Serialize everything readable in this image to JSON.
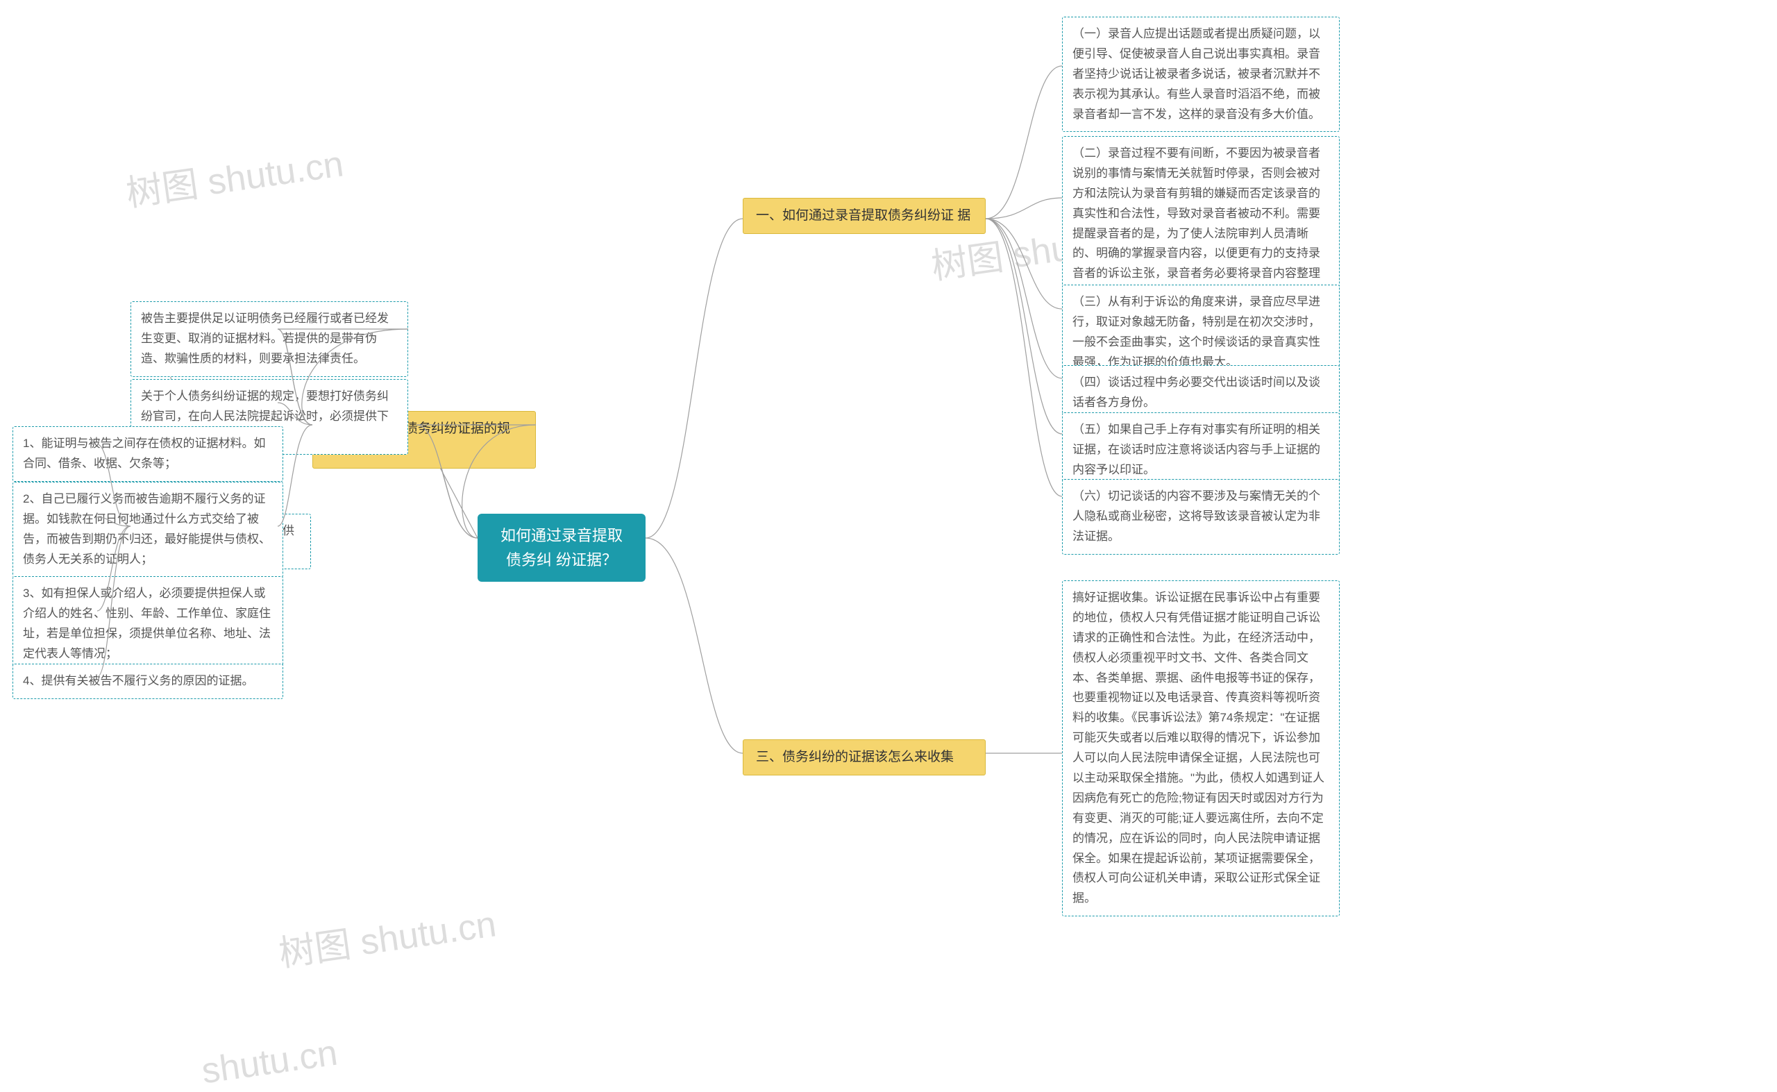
{
  "center": {
    "title": "如何通过录音提取债务纠\n纷证据？"
  },
  "branch1": {
    "title": "一、如何通过录音提取债务纠纷证\n据",
    "leaves": [
      "（一）录音人应提出话题或者提出质疑问题，以便引导、促使被录音人自己说出事实真相。录音者坚持少说话让被录者多说话，被录者沉默并不表示视为其承认。有些人录音时滔滔不绝，而被录音者却一言不发，这样的录音没有多大价值。",
      "（二）录音过程不要有间断，不要因为被录音者说别的事情与案情无关就暂时停录，否则会被对方和法院认为录音有剪辑的嫌疑而否定该录音的真实性和合法性，导致对录音者被动不利。需要提醒录音者的是，为了使人法院审判人员清晰的、明确的掌握录音内容，以便更有力的支持录音者的诉讼主张，录音者务必要将录音内容整理成书面材料，连同录音证据一同提交人民法院。",
      "（三）从有利于诉讼的角度来讲，录音应尽早进行，取证对象越无防备，特别是在初次交涉时，一般不会歪曲事实，这个时候谈话的录音真实性最强，作为证据的价值也最大。",
      "（四）谈话过程中务必要交代出谈话时间以及谈话者各方身份。",
      "（五）如果自己手上存有对事实有所证明的相关证据，在谈话时应注意将谈话内容与手上证据的内容予以印证。",
      "（六）切记谈话的内容不要涉及与案情无关的个人隐私或商业秘密，这将导致该录音被认定为非法证据。"
    ]
  },
  "branch2": {
    "title": "二、对于个人债务纠纷证据的规定",
    "leaf_a": "被告主要提供足以证明债务已经履行或者已经发生变更、取消的证据材料。若提供的是带有伪造、欺骗性质的材料，则要承担法律责任。",
    "leaf_b": "关于个人债务纠纷证据的规定，要想打好债务纠纷官司，在向人民法院提起诉讼时，必须提供下列证据：",
    "sub": {
      "title": "（一）原告（债权人）应提供包括：",
      "items": [
        "1、能证明与被告之间存在债权的证据材料。如合同、借条、收据、欠条等；",
        "2、自己已履行义务而被告逾期不履行义务的证据。如钱款在何日何地通过什么方式交给了被告，而被告到期仍不归还，最好能提供与债权、债务人无关系的证明人；",
        "3、如有担保人或介绍人，必须要提供担保人或介绍人的姓名、性别、年龄、工作单位、家庭住址，若是单位担保，须提供单位名称、地址、法定代表人等情况；",
        "4、提供有关被告不履行义务的原因的证据。"
      ]
    }
  },
  "branch3": {
    "title": "三、债务纠纷的证据该怎么来收集",
    "leaf": "搞好证据收集。诉讼证据在民事诉讼中占有重要的地位，债权人只有凭借证据才能证明自己诉讼请求的正确性和合法性。为此，在经济活动中，债权人必须重视平时文书、文件、各类合同文本、各类单据、票据、函件电报等书证的保存，也要重视物证以及电话录音、传真资料等视听资料的收集。《民事诉讼法》第74条规定：\"在证据可能灭失或者以后难以取得的情况下，诉讼参加人可以向人民法院申请保全证据，人民法院也可以主动采取保全措施。\"为此，债权人如遇到证人因病危有死亡的危险;物证有因天时或因对方行为有变更、消灭的可能;证人要远离住所，去向不定的情况，应在诉讼的同时，向人民法院申请证据保全。如果在提起诉讼前，某项证据需要保全，债权人可向公证机关申请，采取公证形式保全证据。"
  },
  "watermarks": {
    "w1": "树图 shutu.cn",
    "w2": "树图 shutu.cn",
    "w3": "树图 shutu.cn",
    "w4": "shutu.cn"
  }
}
